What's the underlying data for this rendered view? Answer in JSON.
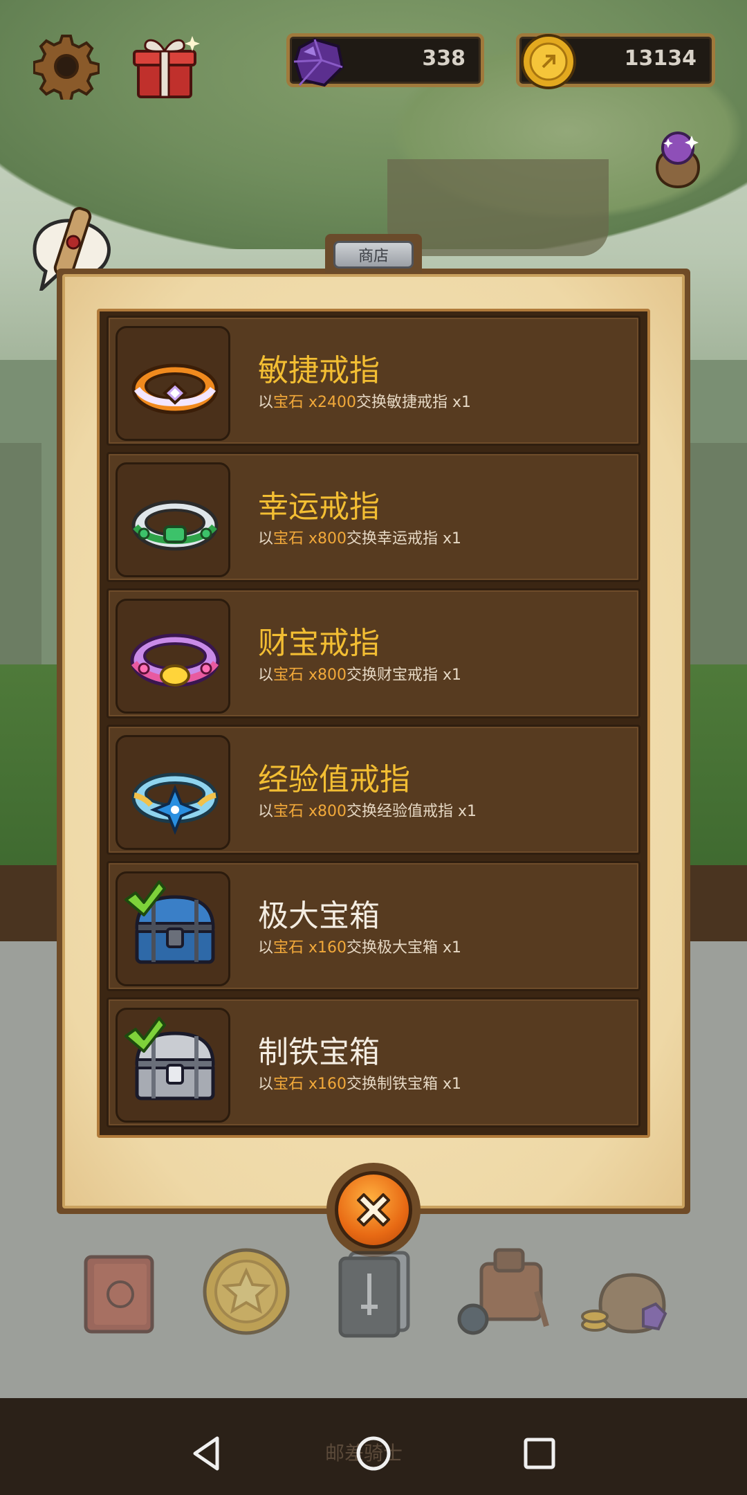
{
  "hud": {
    "gems": "338",
    "coins": "13134"
  },
  "shop": {
    "tab_label": "商店",
    "items": [
      {
        "title": "敏捷戒指",
        "title_color": "#f3be33",
        "desc_prefix": "以",
        "currency": "宝石",
        "amount": "x2400",
        "desc_suffix": "交换敏捷戒指 x1",
        "icon": "agility-ring-icon",
        "purchased": false
      },
      {
        "title": "幸运戒指",
        "title_color": "#f3be33",
        "desc_prefix": "以",
        "currency": "宝石",
        "amount": "x800",
        "desc_suffix": "交换幸运戒指 x1",
        "icon": "luck-ring-icon",
        "purchased": false
      },
      {
        "title": "财宝戒指",
        "title_color": "#f3be33",
        "desc_prefix": "以",
        "currency": "宝石",
        "amount": "x800",
        "desc_suffix": "交换财宝戒指 x1",
        "icon": "treasure-ring-icon",
        "purchased": false
      },
      {
        "title": "经验值戒指",
        "title_color": "#f3be33",
        "desc_prefix": "以",
        "currency": "宝石",
        "amount": "x800",
        "desc_suffix": "交换经验值戒指 x1",
        "icon": "experience-ring-icon",
        "purchased": false
      },
      {
        "title": "极大宝箱",
        "title_color": "#f4ede2",
        "desc_prefix": "以",
        "currency": "宝石",
        "amount": "x160",
        "desc_suffix": "交换极大宝箱 x1",
        "icon": "huge-chest-icon",
        "purchased": true
      },
      {
        "title": "制铁宝箱",
        "title_color": "#f4ede2",
        "desc_prefix": "以",
        "currency": "宝石",
        "amount": "x160",
        "desc_suffix": "交换制铁宝箱 x1",
        "icon": "iron-chest-icon",
        "purchased": true
      }
    ]
  },
  "footer": {
    "text": "邮差骑士"
  }
}
